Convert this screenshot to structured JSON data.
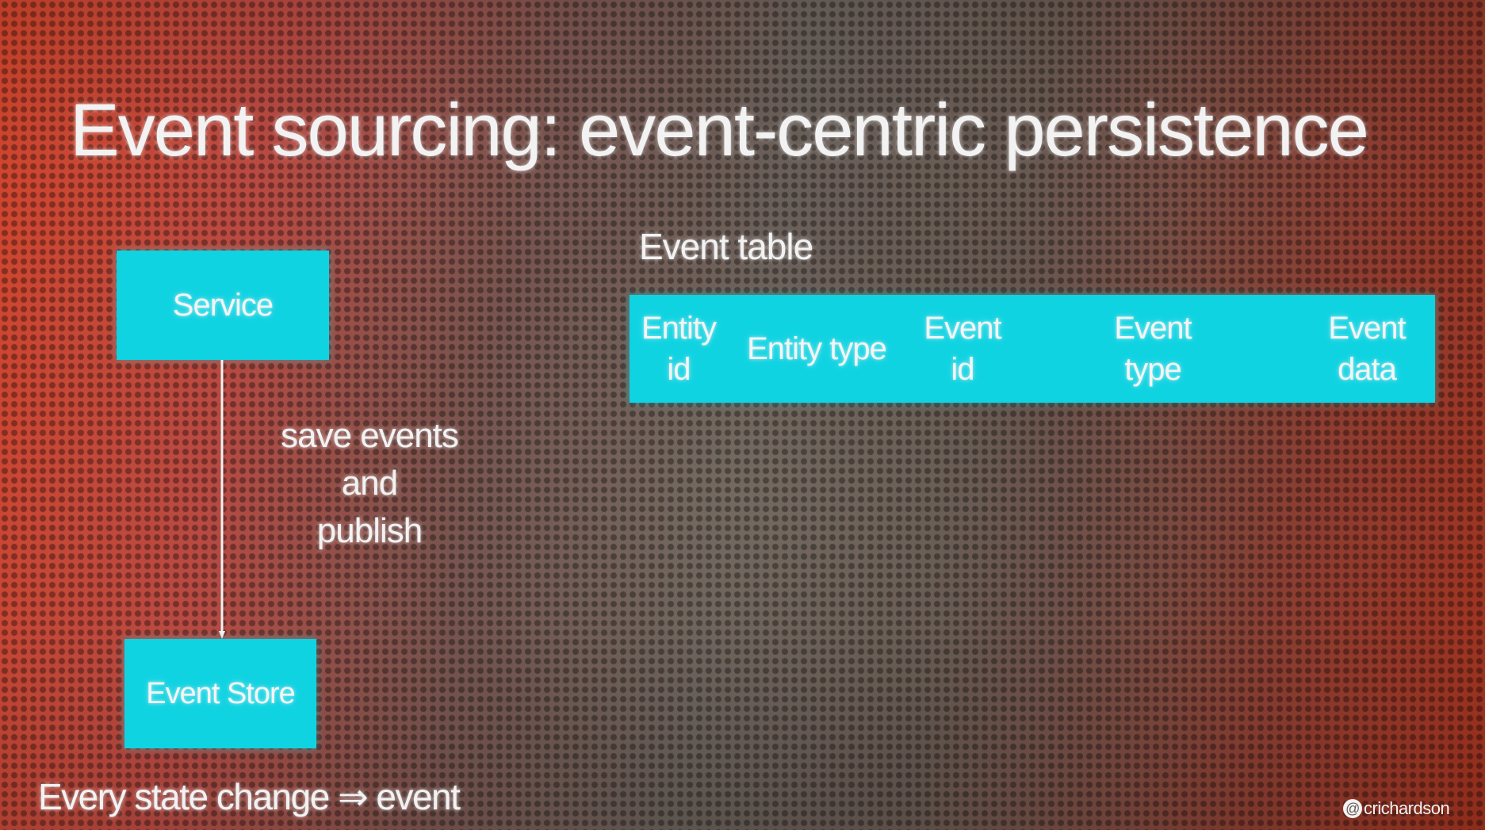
{
  "slide": {
    "title": "Event sourcing: event-centric persistence",
    "footer_note": "Every state change ⇒ event",
    "credit": "crichardson"
  },
  "diagram": {
    "service_label": "Service",
    "event_store_label": "Event Store",
    "connector_label_lines": [
      "save events",
      "and",
      "publish"
    ]
  },
  "event_table": {
    "caption": "Event table",
    "columns": [
      [
        "Entity",
        "id"
      ],
      [
        "Entity type"
      ],
      [
        "Event",
        "id"
      ],
      [
        "Event",
        "type"
      ],
      [
        "Event",
        "data"
      ]
    ]
  },
  "colors": {
    "box_fill": "#10d3e2",
    "text": "#f2f2f2",
    "connector": "#f2f2f2"
  },
  "icons": {
    "credit_icon": "at-sign-icon"
  }
}
